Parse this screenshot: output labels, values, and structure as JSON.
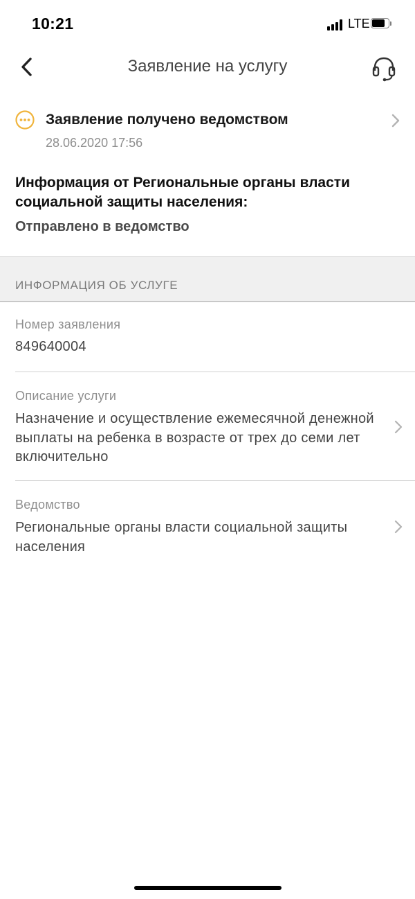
{
  "status_bar": {
    "time": "10:21",
    "network": "LTE"
  },
  "nav": {
    "title": "Заявление на услугу",
    "back_icon": "chevron-left-icon",
    "support_icon": "headset-icon"
  },
  "status": {
    "title": "Заявление получено ведомством",
    "date": "28.06.2020 17:56",
    "icon": "ellipsis-circle-icon",
    "icon_color": "#F0B43C"
  },
  "info": {
    "heading": "Информация от Региональные органы власти социальной защиты населения:",
    "status_text": "Отправлено в ведомство"
  },
  "section": {
    "title": "ИНФОРМАЦИЯ ОБ УСЛУГЕ"
  },
  "fields": [
    {
      "label": "Номер заявления",
      "value": "849640004"
    },
    {
      "label": "Описание услуги",
      "value": "Назначение и осуществление ежемесячной денежной выплаты на ребенка в возрасте от трех до семи лет включительно"
    },
    {
      "label": "Ведомство",
      "value": "Региональные органы власти социальной защиты населения"
    }
  ]
}
